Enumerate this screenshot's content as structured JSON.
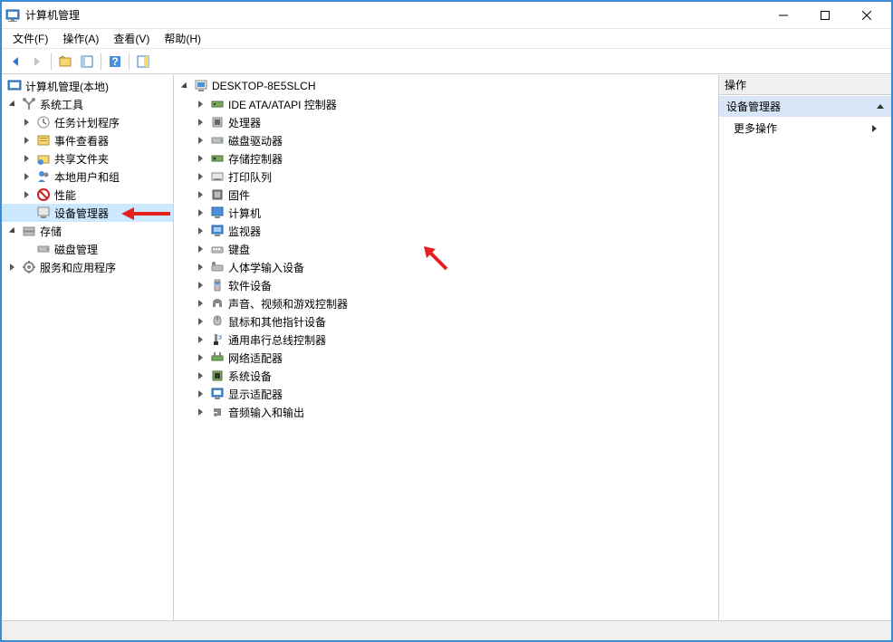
{
  "window": {
    "title": "计算机管理"
  },
  "menu": {
    "file": "文件(F)",
    "action": "操作(A)",
    "view": "查看(V)",
    "help": "帮助(H)"
  },
  "left_tree": {
    "root": "计算机管理(本地)",
    "system_tools": "系统工具",
    "task_scheduler": "任务计划程序",
    "event_viewer": "事件查看器",
    "shared_folders": "共享文件夹",
    "local_users": "本地用户和组",
    "performance": "性能",
    "device_manager": "设备管理器",
    "storage": "存储",
    "disk_management": "磁盘管理",
    "services_apps": "服务和应用程序"
  },
  "mid_tree": {
    "root": "DESKTOP-8E5SLCH",
    "items": [
      "IDE ATA/ATAPI 控制器",
      "处理器",
      "磁盘驱动器",
      "存储控制器",
      "打印队列",
      "固件",
      "计算机",
      "监视器",
      "键盘",
      "人体学输入设备",
      "软件设备",
      "声音、视频和游戏控制器",
      "鼠标和其他指针设备",
      "通用串行总线控制器",
      "网络适配器",
      "系统设备",
      "显示适配器",
      "音频输入和输出"
    ]
  },
  "actions": {
    "header": "操作",
    "section_title": "设备管理器",
    "more_actions": "更多操作"
  }
}
